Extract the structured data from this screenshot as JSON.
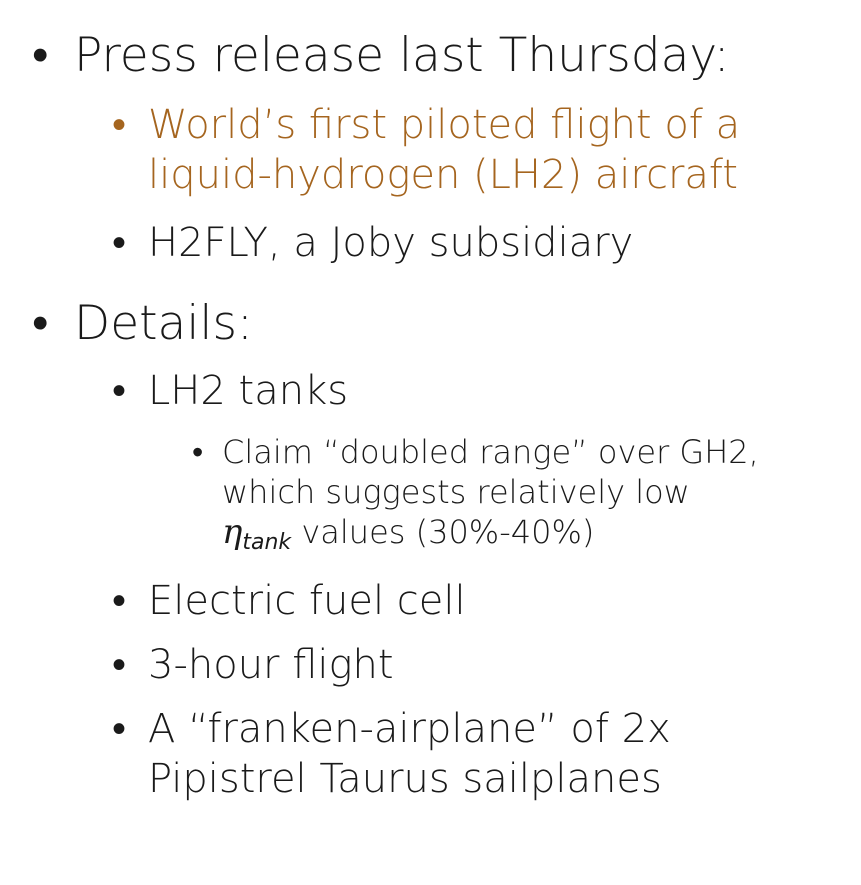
{
  "bullet_char": "•",
  "accent_color": "#a5651f",
  "items": [
    {
      "text": "Press release last Thursday:"
    },
    {
      "lines": [
        "World’s first piloted flight of a",
        "liquid-hydrogen (LH2) aircraft"
      ]
    },
    {
      "text": "H2FLY, a Joby subsidiary"
    },
    {
      "text": "Details:"
    },
    {
      "text": "LH2 tanks"
    },
    {
      "lines": [
        "Claim “doubled range” over GH2,",
        "which suggests relatively low"
      ],
      "math_symbol": "η",
      "math_subscript": "tank",
      "line3_rest": " values (30%-40%)"
    },
    {
      "text": "Electric fuel cell"
    },
    {
      "text": "3-hour flight"
    },
    {
      "lines": [
        "A “franken-airplane” of 2x",
        "Pipistrel Taurus sailplanes"
      ]
    }
  ]
}
